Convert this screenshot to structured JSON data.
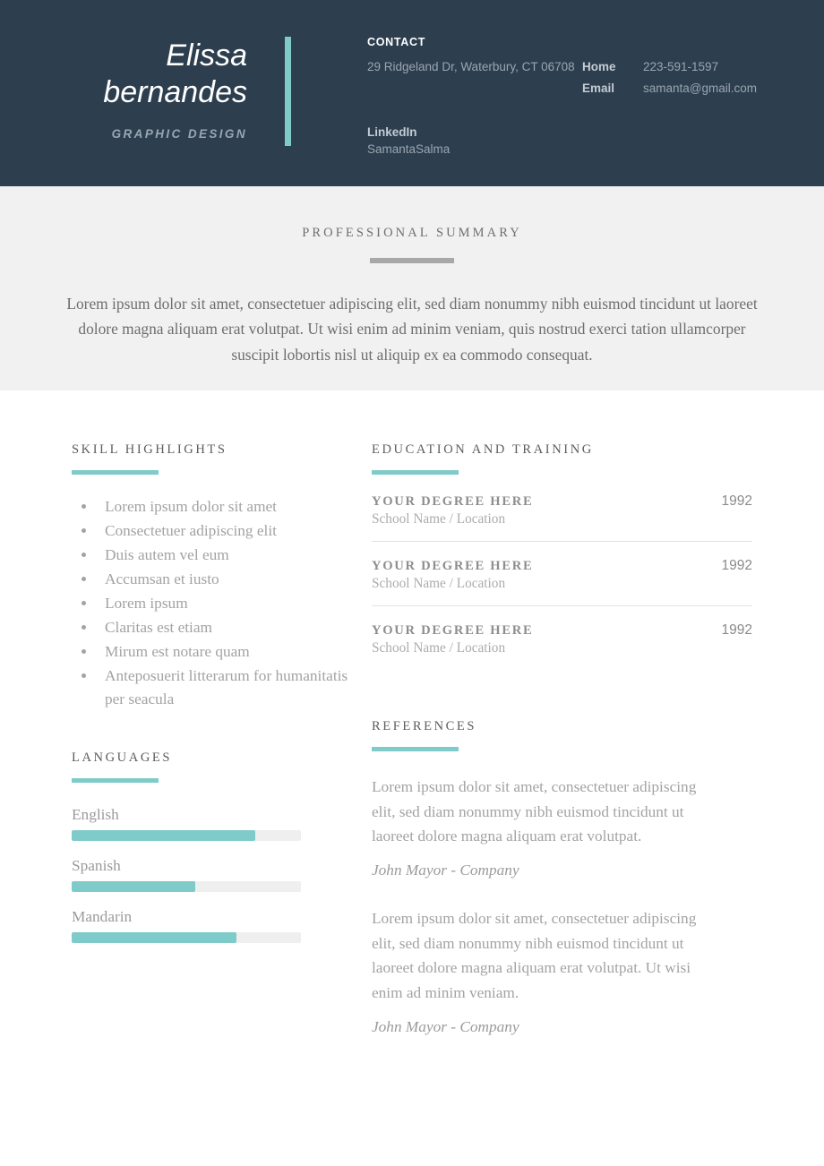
{
  "theme": {
    "header_bg": "#2d3e4f",
    "accent_teal": "#7ecbc9",
    "band_bg": "#f1f1f1",
    "band_rule": "#a8a8a8",
    "body_text": "#a3a3a3"
  },
  "header": {
    "name": "Elissa\nbernandes",
    "role": "GRAPHIC DESIGN",
    "contact": {
      "title": "CONTACT",
      "address": "29 Ridgeland Dr, Waterbury, CT 06708",
      "pairs": [
        {
          "label": "Home",
          "value": "223-591-1597"
        },
        {
          "label": "Email",
          "value": "samanta@gmail.com"
        }
      ],
      "linkedin_label": "LinkedIn",
      "linkedin_value": "SamantaSalma"
    }
  },
  "summary": {
    "title": "PROFESSIONAL SUMMARY",
    "text": "Lorem ipsum dolor sit amet, consectetuer adipiscing elit, sed diam nonummy nibh euismod tincidunt ut laoreet dolore magna aliquam erat volutpat. Ut wisi enim ad minim veniam, quis nostrud exerci tation ullamcorper suscipit lobortis nisl ut aliquip ex ea commodo consequat."
  },
  "skills": {
    "title": "SKILL HIGHLIGHTS",
    "items": [
      "Lorem ipsum dolor sit amet",
      "Consectetuer adipiscing elit",
      "Duis autem vel eum",
      "Accumsan et iusto",
      "Lorem ipsum",
      "Claritas est etiam",
      "Mirum est notare quam",
      "Anteposuerit litterarum for humanitatis per seacula"
    ]
  },
  "languages": {
    "title": "LANGUAGES",
    "items": [
      {
        "name": "English",
        "level": 80
      },
      {
        "name": "Spanish",
        "level": 54
      },
      {
        "name": "Mandarin",
        "level": 72
      }
    ]
  },
  "education": {
    "title": "EDUCATION AND TRAINING",
    "items": [
      {
        "degree": "YOUR DEGREE HERE",
        "year": "1992",
        "school": "School Name / Location"
      },
      {
        "degree": "YOUR DEGREE HERE",
        "year": "1992",
        "school": "School Name / Location"
      },
      {
        "degree": "YOUR DEGREE HERE",
        "year": "1992",
        "school": "School Name / Location"
      }
    ]
  },
  "references": {
    "title": "REFERENCES",
    "items": [
      {
        "text": "Lorem ipsum dolor sit amet, consectetuer adipiscing elit, sed diam nonummy nibh euismod tincidunt ut laoreet dolore magna aliquam erat volutpat.",
        "author": "John Mayor - Company"
      },
      {
        "text": "Lorem ipsum dolor sit amet, consectetuer adipiscing elit, sed diam nonummy nibh euismod tincidunt ut laoreet dolore magna aliquam erat volutpat. Ut wisi enim ad minim veniam.",
        "author": "John Mayor - Company"
      }
    ]
  }
}
